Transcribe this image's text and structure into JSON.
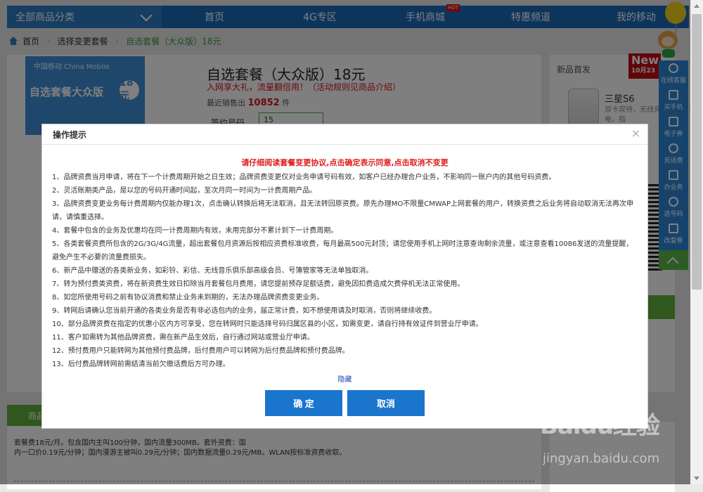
{
  "nav": {
    "category": "全部商品分类",
    "items": [
      "首页",
      "4G专区",
      "手机商城",
      "特惠频道",
      "我的移动"
    ],
    "hot_badge": "HOT"
  },
  "breadcrumb": {
    "home": "首页",
    "step": "选择变更套餐",
    "current": "自选套餐（大众版）18元"
  },
  "product": {
    "thumb_brand": "中国移动 China Mobile",
    "thumb_label": "自选套餐大众版",
    "thumb_num": "18元",
    "title": "自选套餐（大众版）18元",
    "promo": "入网享大礼，流量翻倍用！（活动规则见商品介绍）",
    "sold_prefix": "最近销售出",
    "sold_count": "10852",
    "sold_suffix": "件",
    "field_label": "签约号码",
    "field_value": "15"
  },
  "side": {
    "header": "新品首发",
    "new_badge": "New",
    "new_date": "10月23",
    "phone_name": "三星S6",
    "phone_desc": "双卡双待，无线充电，快速充电，指"
  },
  "bottom": {
    "tab": "商品",
    "text_line1": "套餐费18元/月。包含国内主叫100分钟，国内流量300MB。套外资费：国",
    "text_line2": "内一口价0.19元/分钟；国内漫游主被叫0.29元/分钟；国内数据流量0.29元/MB。WLAN按标准资费收取。"
  },
  "toolbar": {
    "items": [
      {
        "label": "在线客服",
        "icon": "headset-icon"
      },
      {
        "label": "买手机",
        "icon": "phone-icon"
      },
      {
        "label": "电子券",
        "icon": "tag-icon"
      },
      {
        "label": "充话费",
        "icon": "coin-icon"
      },
      {
        "label": "办业务",
        "icon": "pen-icon"
      },
      {
        "label": "选号码",
        "icon": "mouse-icon"
      },
      {
        "label": "改套餐",
        "icon": "edit-icon"
      }
    ]
  },
  "dialog": {
    "title": "操作提示",
    "close": "×",
    "notice": "请仔细阅读套餐变更协议,点击确定表示同意,点击取消不变更",
    "terms": [
      "1、品牌资费当月申请，将在下一个计费周期开始之日生效；品牌资费变更仅对业务申请号码有效，如客户已经办理合户业务，不影响同一账户内的其他号码资费。",
      "2、灵活账期类产品，是以您的号码开通时间起，至次月同一时间为一计费周期产品。",
      "3、品牌资费变更业务每计费周期内仅能办理1次，点击确认转换后将无法取消，且无法转回原资费。原先办理MO不限量CMWAP上网套餐的用户，转换资费之后业务将自动取消无法再次申请，请慎重选择。",
      "4、套餐中包含的业务及优惠均在同一计费周期内有效，未用完部分不累计到下一计费周期。",
      "5、各类套餐资费所包含的2G/3G/4G流量，超出套餐包月资源后按相应资费标准收费，每月最高500元封顶；请您使用手机上网时注意查询剩余流量，或注意查看10086发送的流量提醒，避免产生不必要的流量费损失。",
      "6、新产品中赠送的各类新业务，如彩铃、彩信、无线音乐俱乐部高级会员、号簿管家等无法单独取消。",
      "7、转为预付费类资费，将在新资费生效日扣除当月套餐包月费用，请您提前预存足额话费，避免因扣费造成欠费停机无法正常使用。",
      "8、如您所使用号码之前有协议消费和禁止业务未到期的，无法办理品牌资费变更业务。",
      "9、转网后请确认您当前开通的各类业务是否有非必选包内的业务，届正常计费，如不想使用请及时取消，否则将继续收费。",
      "10、部分品牌资费在指定的优惠小区内方可享受，您在转网时只能选择号码归属区县的小区，如需变更，请自行持有效证件到营业厅申请。",
      "11、客户如需转为其他品牌资费，需在新产品生效后，自行通过网站或营业厅申请。",
      "12、预付费用户只能转网为其他预付费品牌，后付费用户可以转网为后付费品牌和预付费品牌。",
      "13、后付费品牌转网前需结清当前欠缴话费后方可办理。"
    ],
    "hide_link": "隐藏",
    "confirm_label": "确 定",
    "cancel_label": "取消"
  },
  "watermark": {
    "logo": "Baidu经验",
    "url": "jingyan.baidu.com"
  }
}
